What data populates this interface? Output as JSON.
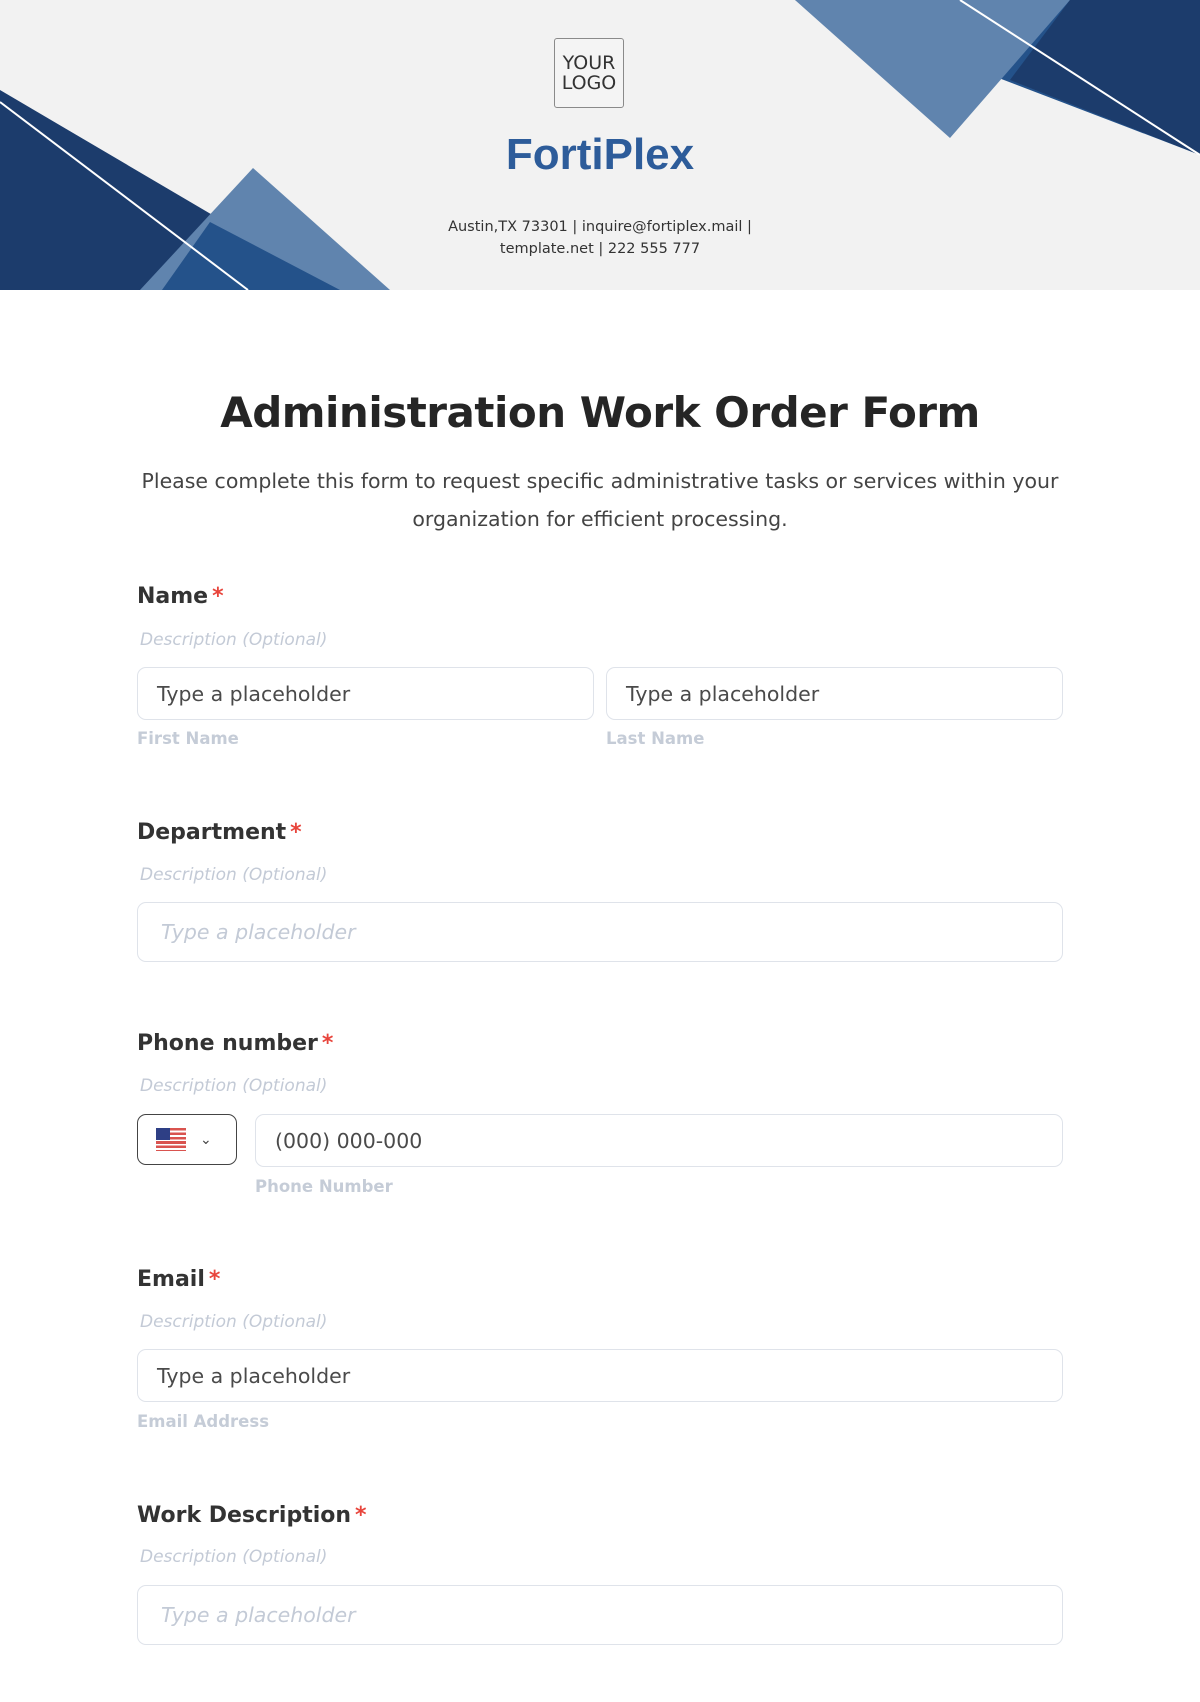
{
  "header": {
    "logo_text": "YOUR LOGO",
    "brand_name": "FortiPlex",
    "contact_line1": "Austin,TX 73301 | inquire@fortiplex.mail |",
    "contact_line2": "template.net | 222 555 777",
    "colors": {
      "dark_blue": "#1c3c6c",
      "mid_blue": "#24528a",
      "light_blue": "#6084ae",
      "brand_text": "#2d5c9a",
      "background": "#f2f2f2"
    }
  },
  "form": {
    "title": "Administration Work Order Form",
    "subtitle": "Please complete this form to request specific administrative tasks or services within your organization for efficient processing.",
    "required_marker": "*",
    "fields": [
      {
        "label": "Name",
        "description": "Description (Optional)",
        "inputs": [
          {
            "placeholder": "Type a placeholder",
            "sublabel": "First Name"
          },
          {
            "placeholder": "Type a placeholder",
            "sublabel": "Last Name"
          }
        ]
      },
      {
        "label": "Department",
        "description": "Description (Optional)",
        "inputs": [
          {
            "placeholder": "Type a placeholder"
          }
        ]
      },
      {
        "label": "Phone number",
        "description": "Description (Optional)",
        "country": {
          "flag": "us-flag-icon",
          "selected": "US"
        },
        "inputs": [
          {
            "placeholder": "(000) 000-000",
            "sublabel": "Phone Number"
          }
        ]
      },
      {
        "label": "Email",
        "description": "Description (Optional)",
        "inputs": [
          {
            "placeholder": "Type a placeholder",
            "sublabel": "Email Address"
          }
        ]
      },
      {
        "label": "Work Description",
        "description": "Description (Optional)",
        "inputs": [
          {
            "placeholder": "Type a placeholder"
          }
        ]
      }
    ]
  },
  "icons": {
    "chevron": "⌄",
    "required_color": "#e8453c"
  }
}
